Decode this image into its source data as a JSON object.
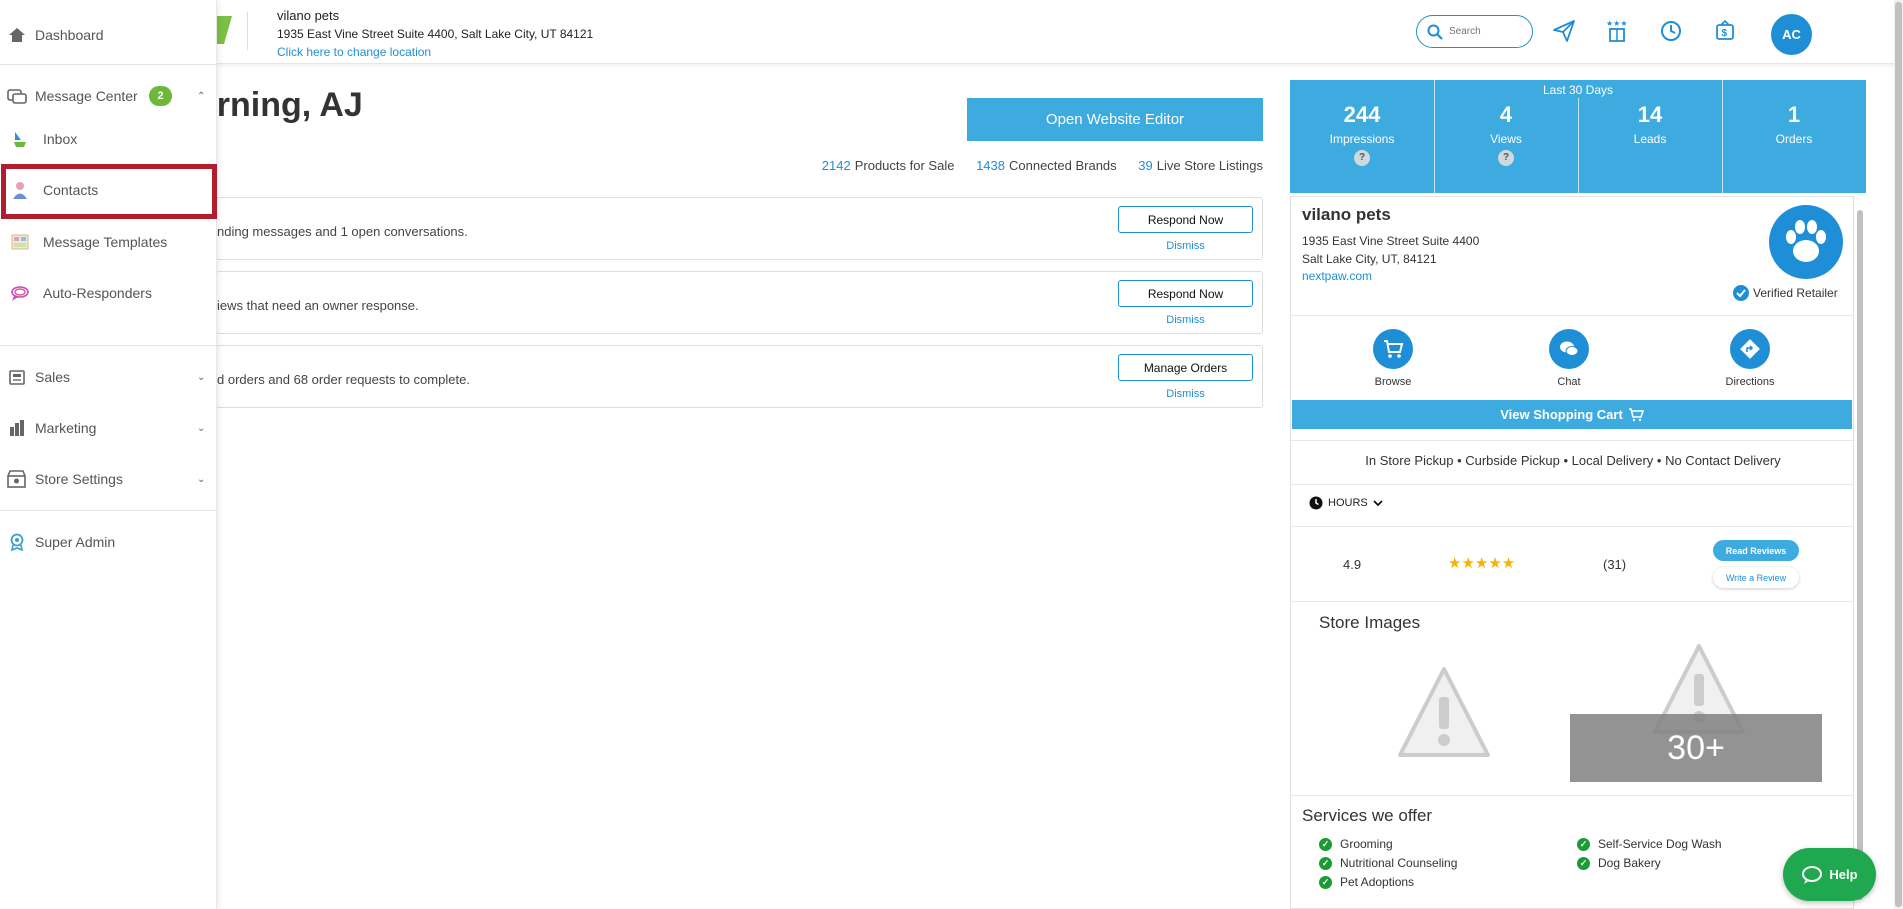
{
  "sidebar": {
    "items": [
      {
        "label": "Dashboard",
        "icon": "home-icon"
      },
      {
        "label": "Message Center",
        "icon": "message-center-icon",
        "badge": "2"
      },
      {
        "label": "Inbox",
        "icon": "inbox-icon"
      },
      {
        "label": "Contacts",
        "icon": "contacts-icon"
      },
      {
        "label": "Message Templates",
        "icon": "templates-icon"
      },
      {
        "label": "Auto-Responders",
        "icon": "auto-responders-icon"
      },
      {
        "label": "Sales",
        "icon": "sales-icon"
      },
      {
        "label": "Marketing",
        "icon": "marketing-icon"
      },
      {
        "label": "Store Settings",
        "icon": "store-settings-icon"
      },
      {
        "label": "Super Admin",
        "icon": "super-admin-icon"
      }
    ],
    "highlight_color": "#b01e2e"
  },
  "header": {
    "location_name": "vilano pets",
    "location_address": "1935 East Vine Street Suite 4400, Salt Lake City, UT 84121",
    "change_location": "Click here to change location",
    "search_placeholder": "Search",
    "avatar_initials": "AC",
    "icons": [
      "send-icon",
      "rewards-icon",
      "clock-icon",
      "billing-icon"
    ]
  },
  "main": {
    "greeting": "orning, AJ",
    "open_editor": "Open Website Editor",
    "stats": [
      {
        "num": "2142",
        "label": "Products for Sale"
      },
      {
        "num": "1438",
        "label": "Connected Brands"
      },
      {
        "num": "39",
        "label": "Live Store Listings"
      }
    ],
    "notices": [
      {
        "text": "nding messages and 1 open conversations.",
        "action": "Respond Now",
        "dismiss": "Dismiss"
      },
      {
        "text": "iews that need an owner response.",
        "action": "Respond Now",
        "dismiss": "Dismiss"
      },
      {
        "text": "d orders and 68 order requests to complete.",
        "action": "Manage Orders",
        "dismiss": "Dismiss"
      }
    ]
  },
  "kpis": {
    "period": "Last 30 Days",
    "items": [
      {
        "value": "244",
        "label": "Impressions",
        "help": "?"
      },
      {
        "value": "4",
        "label": "Views",
        "help": "?"
      },
      {
        "value": "14",
        "label": "Leads"
      },
      {
        "value": "1",
        "label": "Orders"
      }
    ]
  },
  "store": {
    "name": "vilano pets",
    "address1": "1935 East Vine Street Suite 4400",
    "address2": "Salt Lake City, UT, 84121",
    "website": "nextpaw.com",
    "verified": "Verified Retailer",
    "actions": [
      {
        "label": "Browse"
      },
      {
        "label": "Chat"
      },
      {
        "label": "Directions"
      }
    ],
    "cart_button": "View Shopping Cart",
    "fulfillment": "In Store Pickup • Curbside Pickup • Local Delivery • No Contact Delivery",
    "hours_label": "HOURS",
    "rating": "4.9",
    "stars": "★★★★★",
    "review_count": "(31)",
    "read_reviews": "Read Reviews",
    "write_review": "Write a Review",
    "images_title": "Store Images",
    "more_images": "30+",
    "services_title": "Services we offer",
    "services": [
      "Grooming",
      "Self-Service Dog Wash",
      "Nutritional Counseling",
      "Dog Bakery",
      "Pet Adoptions"
    ]
  },
  "help_button": "Help",
  "colors": {
    "accent": "#3daae0",
    "link": "#1e8fd6",
    "badge": "#6cb83a",
    "help": "#1fa84f"
  }
}
